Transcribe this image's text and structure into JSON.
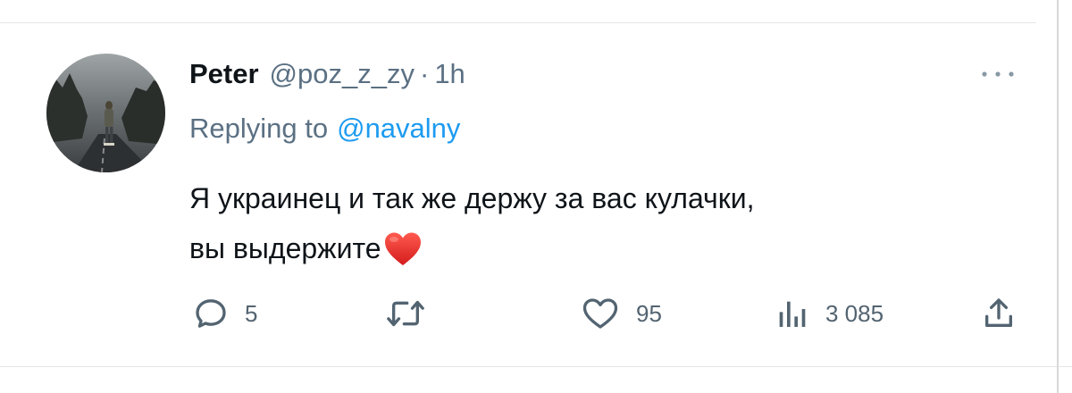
{
  "tweet": {
    "author_name": "Peter",
    "author_handle": "@poz_z_zy",
    "separator": "·",
    "time_ago": "1h",
    "reply_prefix": "Replying to",
    "reply_mention": "@navalny",
    "text_line1": "Я украинец и так же держу за вас кулачки,",
    "text_line2": "вы выдержите",
    "emoji": "red-heart-emoji"
  },
  "actions": {
    "reply_count": "5",
    "retweet_count": "",
    "like_count": "95",
    "views_count": "3 085"
  },
  "icons": {
    "reply": "speech-bubble-icon",
    "retweet": "retweet-icon",
    "like": "heart-outline-icon",
    "views": "bar-chart-icon",
    "share": "share-upload-icon",
    "more": "more-dots-icon"
  },
  "colors": {
    "text_primary": "#0f1419",
    "text_secondary": "#5b7083",
    "link": "#1d9bf0",
    "heart": "#e0245e"
  }
}
